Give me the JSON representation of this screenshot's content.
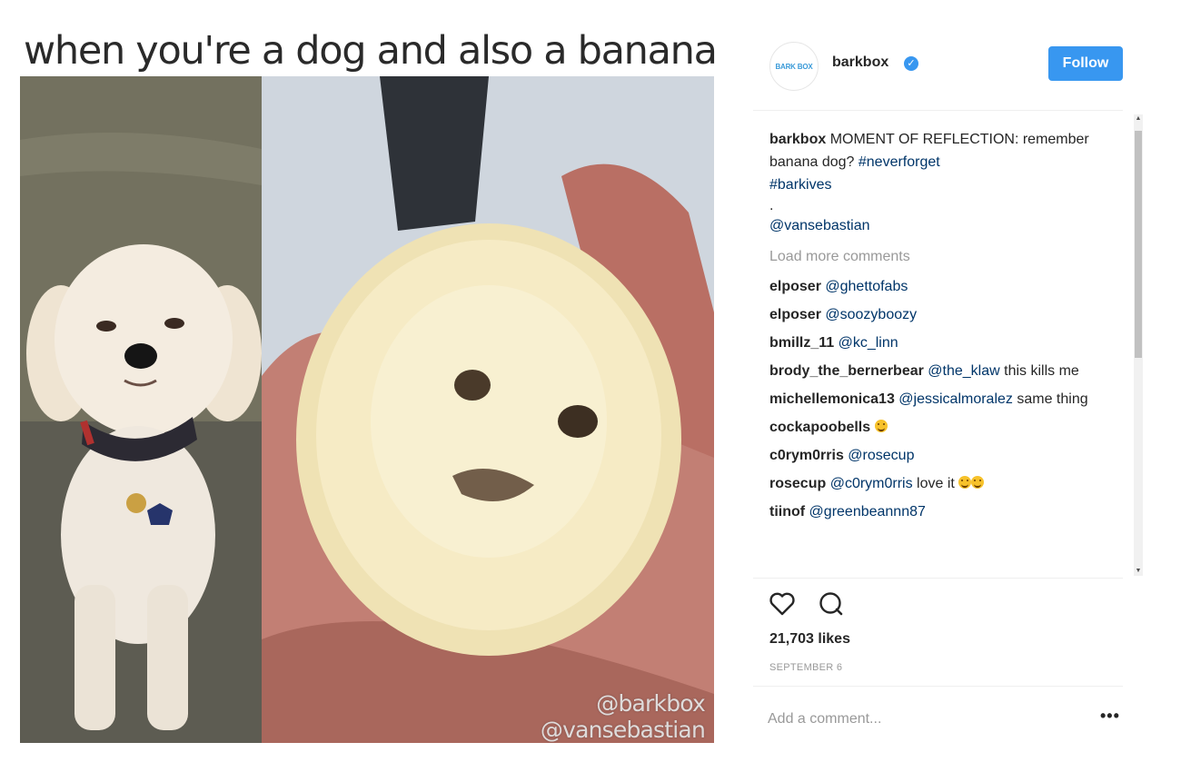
{
  "post_image": {
    "caption": "when you're a dog and also a banana",
    "watermark_line1": "@barkbox",
    "watermark_line2": "@vansebastian"
  },
  "header": {
    "avatar_text": "BARK BOX",
    "username": "barkbox",
    "verified": true,
    "follow_label": "Follow"
  },
  "caption": {
    "user": "barkbox",
    "text": " MOMENT OF REFLECTION: remember banana dog? ",
    "tag1": "#neverforget",
    "tag2": "#barkives",
    "dot": ".",
    "mention": "@vansebastian"
  },
  "load_more_label": "Load more comments",
  "comments": [
    {
      "user": "elposer",
      "mention": "@ghettofabs",
      "text": ""
    },
    {
      "user": "elposer",
      "mention": "@soozyboozy",
      "text": ""
    },
    {
      "user": "bmillz_11",
      "mention": "@kc_linn",
      "text": ""
    },
    {
      "user": "brody_the_bernerbear",
      "mention": "@the_klaw",
      "text": " this kills me"
    },
    {
      "user": "michellemonica13",
      "mention": "@jessicalmoralez",
      "text": " same thing"
    },
    {
      "user": "cockapoobells",
      "mention": "",
      "text": ""
    },
    {
      "user": "c0rym0rris",
      "mention": "@rosecup",
      "text": ""
    },
    {
      "user": "rosecup",
      "mention": "@c0rym0rris",
      "text": " love it"
    },
    {
      "user": "tiinof",
      "mention": "@greenbeannn87",
      "text": ""
    }
  ],
  "icons": {
    "like": "heart-icon",
    "comment": "comment-icon",
    "more": "more-options-icon"
  },
  "stats": {
    "likes": "21,703 likes",
    "date": "SEPTEMBER 6"
  },
  "add_comment": {
    "placeholder": "Add a comment...",
    "more_label": "•••"
  },
  "colors": {
    "follow_button": "#3897f0",
    "link": "#003569",
    "muted": "#999999"
  }
}
